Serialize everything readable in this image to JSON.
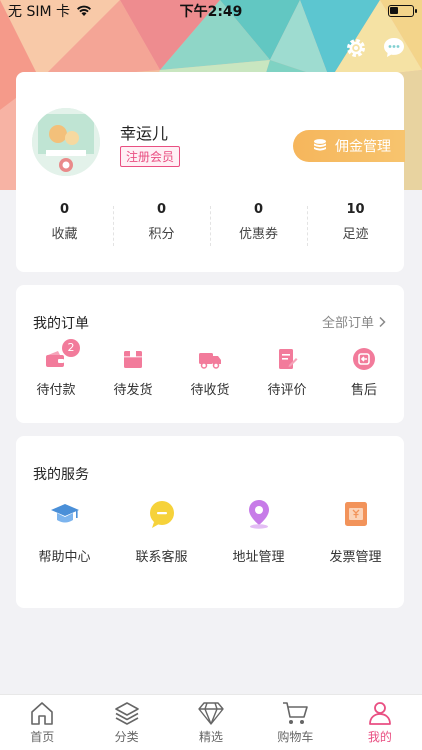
{
  "status_bar": {
    "carrier": "无 SIM 卡",
    "time": "下午2:49"
  },
  "profile": {
    "username": "幸运儿",
    "member_badge": "注册会员",
    "commission_button": "佣金管理",
    "stats": [
      {
        "value": "0",
        "label": "收藏"
      },
      {
        "value": "0",
        "label": "积分"
      },
      {
        "value": "0",
        "label": "优惠券"
      },
      {
        "value": "10",
        "label": "足迹"
      }
    ]
  },
  "orders": {
    "title": "我的订单",
    "all_link": "全部订单",
    "items": [
      {
        "label": "待付款",
        "icon": "wallet-icon",
        "badge": "2"
      },
      {
        "label": "待发货",
        "icon": "box-icon"
      },
      {
        "label": "待收货",
        "icon": "truck-icon"
      },
      {
        "label": "待评价",
        "icon": "review-icon"
      },
      {
        "label": "售后",
        "icon": "after-sale-icon"
      }
    ]
  },
  "services": {
    "title": "我的服务",
    "items": [
      {
        "label": "帮助中心",
        "icon": "graduation-cap-icon"
      },
      {
        "label": "联系客服",
        "icon": "chat-bubble-icon"
      },
      {
        "label": "地址管理",
        "icon": "location-pin-icon"
      },
      {
        "label": "发票管理",
        "icon": "invoice-icon"
      }
    ]
  },
  "tabbar": {
    "items": [
      {
        "label": "首页",
        "icon": "home-icon"
      },
      {
        "label": "分类",
        "icon": "layers-icon"
      },
      {
        "label": "精选",
        "icon": "diamond-icon"
      },
      {
        "label": "购物车",
        "icon": "cart-icon"
      },
      {
        "label": "我的",
        "icon": "user-icon",
        "active": true
      }
    ]
  },
  "colors": {
    "accent": "#e94f82",
    "commission_bg": "#f6b65c",
    "order_icon": "#f27b9b"
  }
}
